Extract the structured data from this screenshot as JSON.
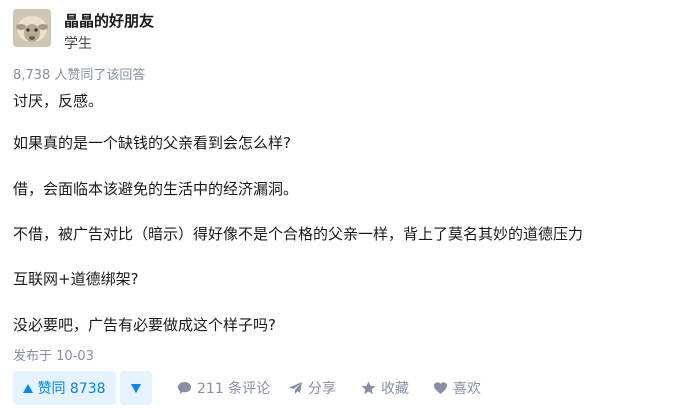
{
  "author": {
    "name": "晶晶的好朋友",
    "bio": "学生"
  },
  "votes_summary": "8,738 人赞同了该回答",
  "content": {
    "paragraphs": [
      "讨厌，反感。",
      "如果真的是一个缺钱的父亲看到会怎么样?",
      "借，会面临本该避免的生活中的经济漏洞。",
      "不借，被广告对比（暗示）得好像不是个合格的父亲一样，背上了莫名其妙的道德压力",
      "互联网+道德绑架?",
      "没必要吧，广告有必要做成这个样子吗?"
    ]
  },
  "publish_time": "发布于 10-03",
  "actions": {
    "vote_up_label": "赞同 8738",
    "comment_label": "211 条评论",
    "share_label": "分享",
    "collect_label": "收藏",
    "like_label": "喜欢"
  },
  "colors": {
    "accent": "#0084ff",
    "accent_bg": "#e5f2ff",
    "meta_gray": "#8590a6"
  },
  "icons": {
    "vote_up": "triangle-up-icon",
    "vote_down": "triangle-down-icon",
    "comment": "comment-bubble-icon",
    "share": "paper-plane-icon",
    "collect": "star-icon",
    "like": "heart-icon"
  }
}
